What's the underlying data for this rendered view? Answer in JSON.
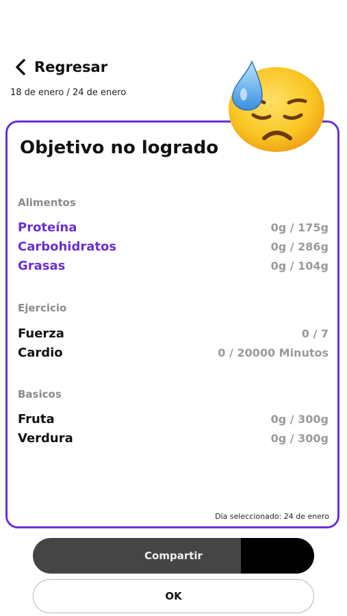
{
  "header": {
    "back_label": "Regresar",
    "date_range": "18 de enero / 24 de enero"
  },
  "card": {
    "title": "Objetivo no logrado",
    "sections": [
      {
        "label": "Alimentos",
        "items": [
          {
            "name": "Proteína",
            "value": "0g / 175g"
          },
          {
            "name": "Carbohidratos",
            "value": "0g / 286g"
          },
          {
            "name": "Grasas",
            "value": "0g / 104g"
          }
        ]
      },
      {
        "label": "Ejercicio",
        "items": [
          {
            "name": "Fuerza",
            "value": "0 / 7"
          },
          {
            "name": "Cardio",
            "value": "0 / 20000 Minutos"
          }
        ]
      },
      {
        "label": "Basicos",
        "items": [
          {
            "name": "Fruta",
            "value": "0g / 300g"
          },
          {
            "name": "Verdura",
            "value": "0g / 300g"
          }
        ]
      }
    ],
    "selected_day": "Día seleccionado: 24 de enero"
  },
  "buttons": {
    "share_label": "Compartir",
    "ok_label": "OK"
  },
  "colors": {
    "accent": "#6a2fd3",
    "muted": "#9a9a9a"
  },
  "icons": {
    "back": "chevron-left-icon",
    "emoji": "downcast-face-with-sweat-emoji"
  }
}
